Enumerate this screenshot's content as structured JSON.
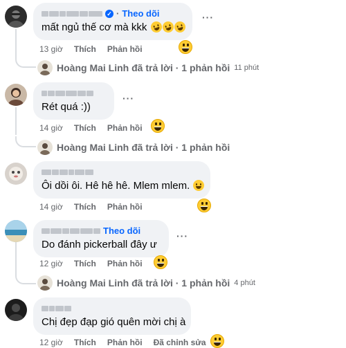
{
  "comments": [
    {
      "follow": "Theo dõi",
      "text": "mất ngủ thế cơ mà kkk",
      "time": "13 giờ",
      "like": "Thích",
      "reply": "Phản hồi",
      "reply_thread": {
        "text": "Hoàng Mai Linh đã trả lời · 1 phản hồi",
        "time": "11 phút"
      }
    },
    {
      "text": "Rét quá :))",
      "time": "14 giờ",
      "like": "Thích",
      "reply": "Phản hồi",
      "reply_thread": {
        "text": "Hoàng Mai Linh đã trả lời · 1 phản hồi"
      }
    },
    {
      "text": "Ôi dồi ôi. Hê hê hê. Mlem mlem.",
      "time": "14 giờ",
      "like": "Thích",
      "reply": "Phản hồi"
    },
    {
      "follow": "Theo dõi",
      "text": "Do đánh pickerball đây ư",
      "time": "12 giờ",
      "like": "Thích",
      "reply": "Phản hồi",
      "reply_thread": {
        "text": "Hoàng Mai Linh đã trả lời · 1 phản hồi",
        "time": "4 phút"
      }
    },
    {
      "text": "Chị đẹp đạp gió quên mời chị à",
      "time": "12 giờ",
      "like": "Thích",
      "reply": "Phản hồi",
      "edited": "Đã chỉnh sửa"
    }
  ],
  "more_icon": "more-horizontal-icon",
  "react_icon": "grinning-face-icon",
  "verified_icon": "verified-badge-icon",
  "colors": {
    "link": "#0866ff",
    "bubble": "#f0f2f5",
    "meta": "#65676b"
  }
}
